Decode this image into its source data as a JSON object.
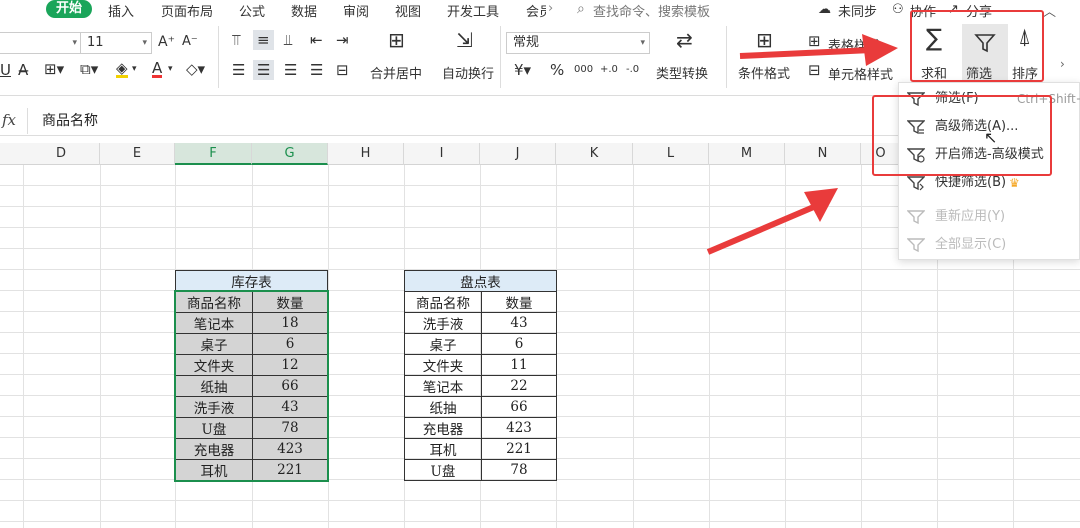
{
  "menu": {
    "tabs": [
      "开始",
      "插入",
      "页面布局",
      "公式",
      "数据",
      "审阅",
      "视图",
      "开发工具",
      "会员"
    ],
    "more": "›",
    "search_placeholder": "查找命令、搜索模板",
    "sync": "未同步",
    "collab": "协作",
    "share": "分享"
  },
  "ribbon": {
    "font_size": "11",
    "font_size_grow": "A⁺",
    "font_size_shrink": "A⁻",
    "merge_center": "合并居中",
    "wrap_text": "自动换行",
    "number_format": "常规",
    "percent": "%",
    "thousands": "000",
    "dec_inc": "+.0",
    "dec_dec": "-.0",
    "type_convert": "类型转换",
    "cond_format": "条件格式",
    "table_style": "表格样式",
    "cell_style": "单元格样式",
    "sum": "求和",
    "filter": "筛选",
    "sort": "排序"
  },
  "formula_bar": {
    "fx": "fx",
    "content": "商品名称"
  },
  "columns": [
    "D",
    "E",
    "F",
    "G",
    "H",
    "I",
    "J",
    "K",
    "L",
    "M",
    "N",
    "O"
  ],
  "inventory": {
    "title": "库存表",
    "headers": [
      "商品名称",
      "数量"
    ],
    "rows": [
      [
        "笔记本",
        "18"
      ],
      [
        "桌子",
        "6"
      ],
      [
        "文件夹",
        "12"
      ],
      [
        "纸抽",
        "66"
      ],
      [
        "洗手液",
        "43"
      ],
      [
        "U盘",
        "78"
      ],
      [
        "充电器",
        "423"
      ],
      [
        "耳机",
        "221"
      ]
    ]
  },
  "stocktake": {
    "title": "盘点表",
    "headers": [
      "商品名称",
      "数量"
    ],
    "rows": [
      [
        "洗手液",
        "43"
      ],
      [
        "桌子",
        "6"
      ],
      [
        "文件夹",
        "11"
      ],
      [
        "笔记本",
        "22"
      ],
      [
        "纸抽",
        "66"
      ],
      [
        "充电器",
        "423"
      ],
      [
        "耳机",
        "221"
      ],
      [
        "U盘",
        "78"
      ]
    ]
  },
  "filter_menu": {
    "items": [
      {
        "label": "筛选(F)",
        "shortcut": "Ctrl+Shift+L",
        "disabled": false
      },
      {
        "label": "高级筛选(A)...",
        "disabled": false
      },
      {
        "label": "开启筛选-高级模式",
        "disabled": false
      },
      {
        "label": "快捷筛选(B)",
        "disabled": false
      },
      {
        "label": "重新应用(Y)",
        "disabled": true
      },
      {
        "label": "全部显示(C)",
        "disabled": true
      }
    ]
  },
  "colors": {
    "accent": "#1aa55a",
    "highlight": "#e93b3b",
    "table_title_bg": "#ddebf7",
    "selected_bg": "#d4d4d4"
  }
}
